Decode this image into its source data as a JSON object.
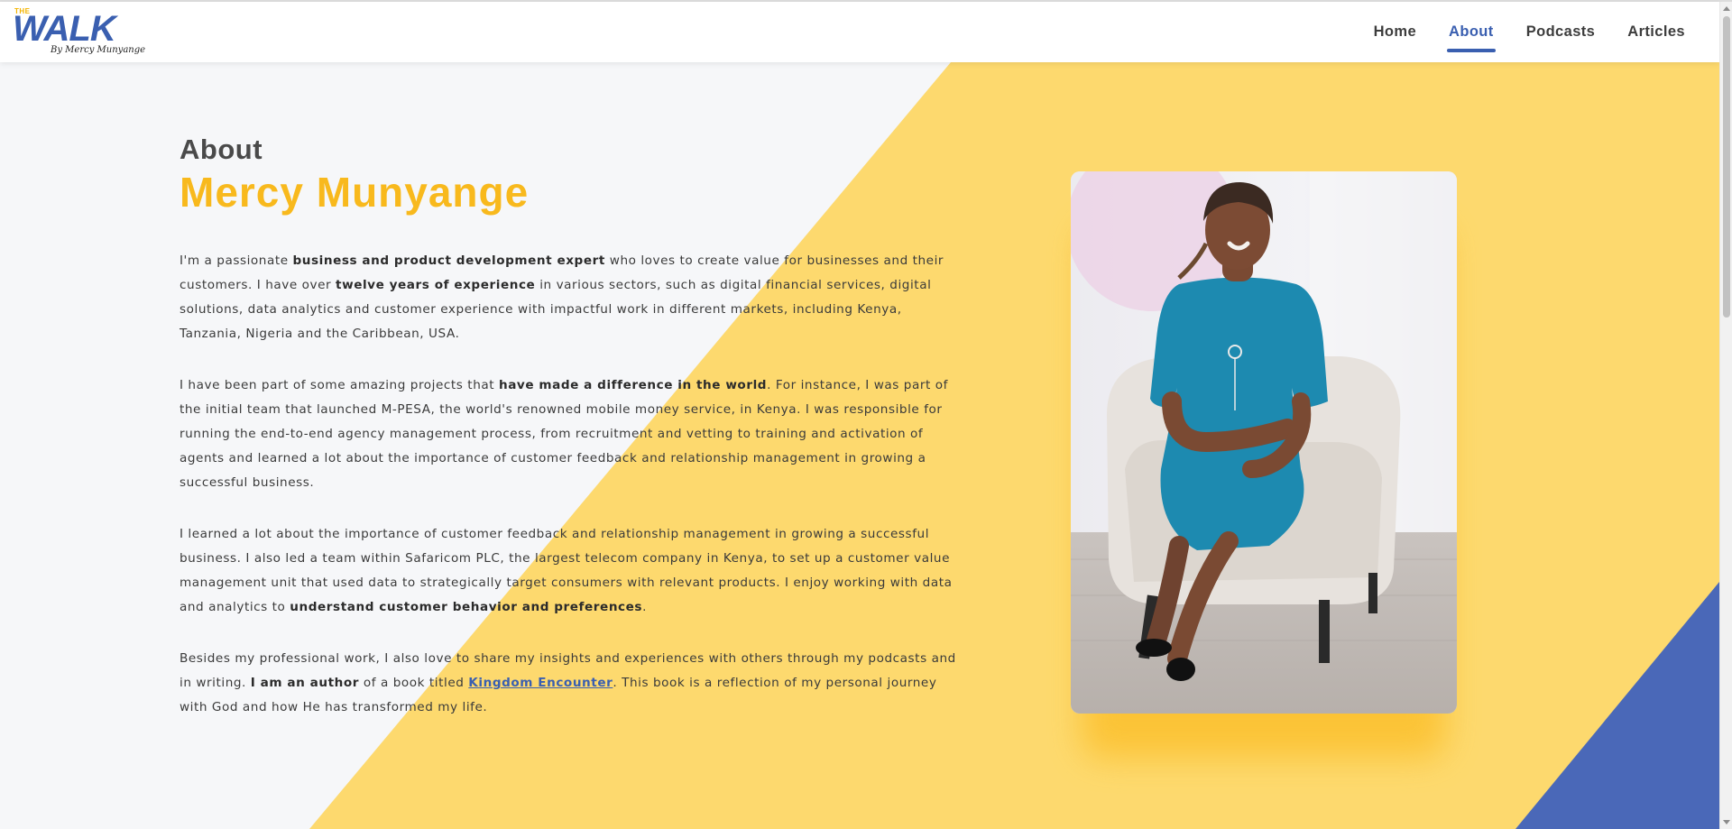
{
  "header": {
    "logo": {
      "the": "THE",
      "walk": "WALK",
      "by": "By Mercy Munyange"
    },
    "nav": [
      {
        "label": "Home",
        "active": false
      },
      {
        "label": "About",
        "active": true
      },
      {
        "label": "Podcasts",
        "active": false
      },
      {
        "label": "Articles",
        "active": false
      }
    ]
  },
  "colors": {
    "accent_blue": "#3a5fb0",
    "accent_yellow": "#f8b91d",
    "bg_yellow": "#fdd96e",
    "bg_light": "#f6f7f9"
  },
  "main": {
    "heading": "About",
    "name": "Mercy Munyange",
    "paragraphs": [
      {
        "p1": "I'm a passionate ",
        "b1": "business and product development expert",
        "p2": " who loves to create value for businesses and their customers. I have over ",
        "b2": "twelve years of experience",
        "p3": " in various sectors, such as digital financial services, digital solutions, data analytics and customer experience with impactful work in different markets, including Kenya, Tanzania, Nigeria and the Caribbean, USA."
      },
      {
        "p1": "I have been part of some amazing projects that ",
        "b1": "have made a difference in the world",
        "p2": ". For instance, I was part of the initial team that launched M-PESA, the world's renowned mobile money service, in Kenya. I was responsible for running the end-to-end agency management process, from recruitment and vetting to training and activation of agents and learned a lot about the importance of customer feedback and relationship management in growing a successful business."
      },
      {
        "p1": "I learned a lot about the importance of customer feedback and relationship management in growing a successful business. I also led a team within Safaricom PLC, the largest telecom company in Kenya, to set up a customer value management unit that used data to strategically target consumers with relevant products. I enjoy working with data and analytics to ",
        "b1": "understand customer behavior and preferences",
        "p2": "."
      },
      {
        "p1": "Besides my professional work, I also love to share my insights and experiences with others through my podcasts and in writing. ",
        "b1": "I am an author",
        "p2": " of a book titled ",
        "link": "Kingdom Encounter",
        "p3": ". This book is a reflection of my personal journey with God and how He has transformed my life."
      }
    ]
  }
}
